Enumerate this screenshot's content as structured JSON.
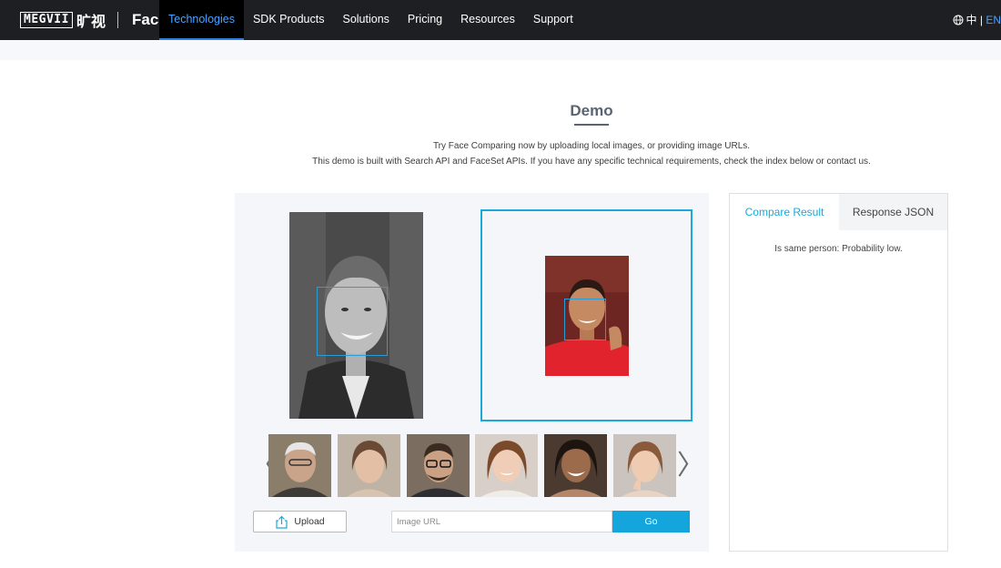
{
  "nav": {
    "brand": {
      "megvii": "MEGVII",
      "cn": "旷视",
      "face": "Face",
      "face_sup": "++"
    },
    "items": [
      {
        "label": "Technologies",
        "active": true
      },
      {
        "label": "SDK Products"
      },
      {
        "label": "Solutions"
      },
      {
        "label": "Pricing"
      },
      {
        "label": "Resources"
      },
      {
        "label": "Support"
      }
    ],
    "lang": {
      "icon": "globe-icon",
      "zh": "中",
      "sep": " | ",
      "en": "EN"
    }
  },
  "demo": {
    "title": "Demo",
    "desc1": "Try Face Comparing now by uploading local images, or providing image URLs.",
    "desc2": "This demo is built with Search API and FaceSet APIs. If you have any specific technical requirements, check the index below or contact us."
  },
  "controls": {
    "upload_label": "Upload",
    "url_placeholder": "Image URL",
    "go_label": "Go",
    "prev_arrow": "〈",
    "next_arrow": "〉"
  },
  "result": {
    "tabs": [
      {
        "label": "Compare Result",
        "active": true
      },
      {
        "label": "Response JSON"
      }
    ],
    "text": "Is same person: Probability low."
  },
  "colors": {
    "accent": "#1aa9d8",
    "nav_bg": "#1e1f22",
    "nav_active": "#4aa3ff"
  }
}
